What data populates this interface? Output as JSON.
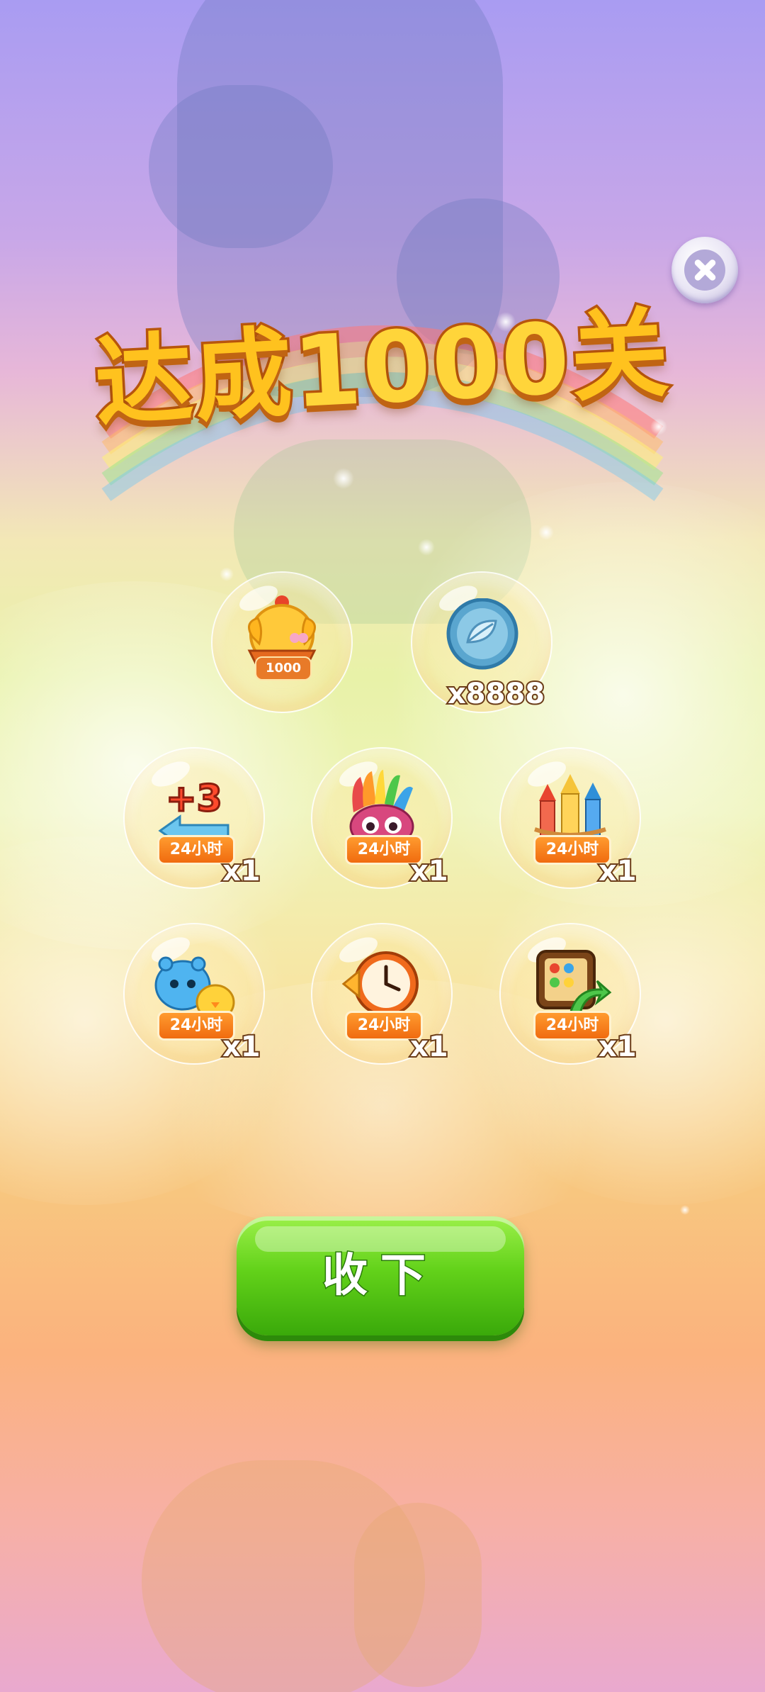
{
  "title": {
    "prefix": "达成",
    "number": "1000",
    "suffix": "关"
  },
  "close_button": {
    "icon": "close-icon"
  },
  "rewards": {
    "row1": [
      {
        "name": "chick-frame-1000",
        "badge": "1000",
        "qty": ""
      },
      {
        "name": "leaf-coin",
        "badge": "",
        "qty": "x8888"
      }
    ],
    "row2": [
      {
        "name": "plus-3-moves",
        "badge": "24小时",
        "qty": "x1"
      },
      {
        "name": "rainbow-owl",
        "badge": "24小时",
        "qty": "x1"
      },
      {
        "name": "rockets",
        "badge": "24小时",
        "qty": "x1"
      }
    ],
    "row3": [
      {
        "name": "blue-critter-chick",
        "badge": "24小时",
        "qty": "x1"
      },
      {
        "name": "clock",
        "badge": "24小时",
        "qty": "x1"
      },
      {
        "name": "board-shuffle",
        "badge": "24小时",
        "qty": "x1"
      }
    ]
  },
  "collect_button": {
    "label": "收下"
  },
  "colors": {
    "title_fill": "#ffc21e",
    "title_stroke": "#b9560d",
    "button_green": "#63d21a",
    "badge_orange": "#f06b0f"
  }
}
